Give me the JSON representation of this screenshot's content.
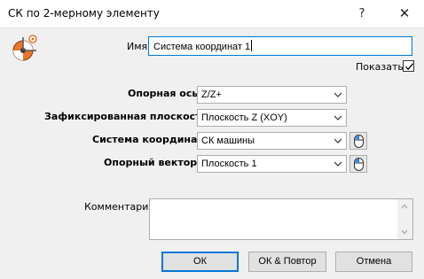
{
  "window": {
    "title": "СК по 2-мерному элементу",
    "help_symbol": "?",
    "close_symbol": "✕"
  },
  "icons": {
    "app": "coordinate-system-icon",
    "checkmark": "check-icon",
    "mouse": "mouse-pick-icon",
    "dropdown": "chevron-down-icon"
  },
  "form": {
    "name_label": "Имя",
    "name_value": "Система координат 1",
    "show_label": "Показать",
    "show_checked": true,
    "ref_axis_label": "Опорная ось",
    "ref_axis_value": "Z/Z+",
    "fixed_plane_label": "Зафиксированная плоскость",
    "fixed_plane_value": "Плоскость Z (XOY)",
    "coord_system_label": "Система координат",
    "coord_system_value": "СК машины",
    "ref_vector_label": "Опорный вектор",
    "ref_vector_value": "Плоскость 1",
    "comment_label": "Комментарий",
    "comment_value": ""
  },
  "buttons": {
    "ok": "ОК",
    "ok_repeat": "ОК & Повтор",
    "cancel": "Отмена"
  },
  "colors": {
    "accent": "#0078d7",
    "icon_orange": "#e8762c"
  }
}
